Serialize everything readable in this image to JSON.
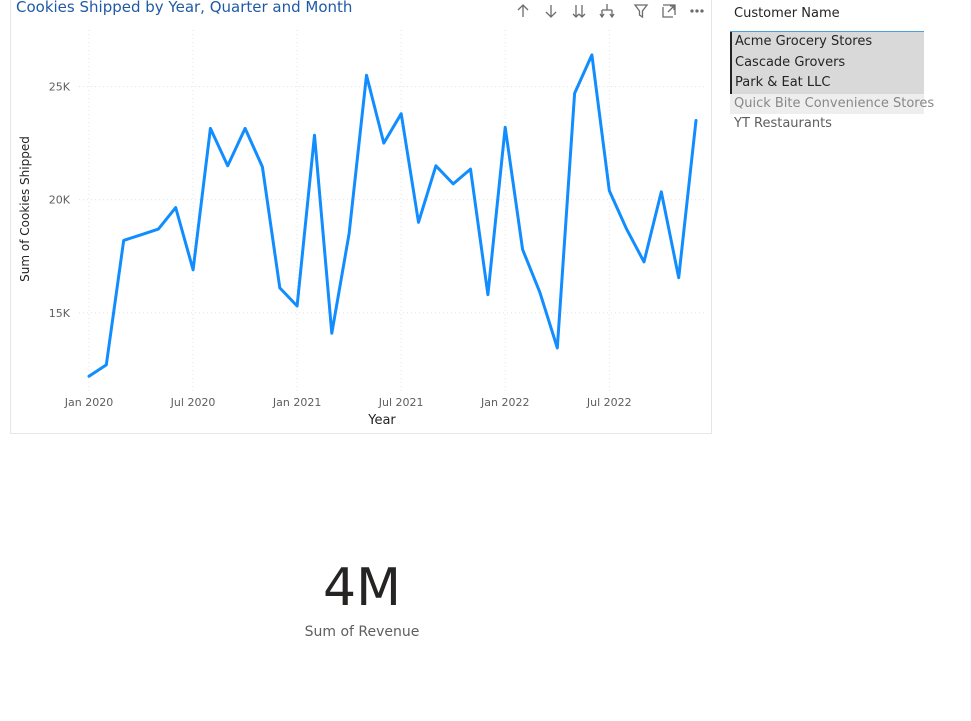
{
  "chart": {
    "title": "Cookies Shipped by Year, Quarter and Month",
    "toolbar_icons": [
      "drill-up-icon",
      "drill-down-icon",
      "expand-all-down-icon",
      "expand-hierarchy-icon",
      "filter-icon",
      "focus-mode-icon",
      "more-options-icon"
    ]
  },
  "chart_data": {
    "type": "line",
    "title": "Cookies Shipped by Year, Quarter and Month",
    "xlabel": "Year",
    "ylabel": "Sum of Cookies Shipped",
    "x_tick_labels": [
      "Jan 2020",
      "Jul 2020",
      "Jan 2021",
      "Jul 2021",
      "Jan 2022",
      "Jul 2022"
    ],
    "y_tick_labels": [
      "15K",
      "20K",
      "25K"
    ],
    "ylim": [
      11500,
      27500
    ],
    "grid": true,
    "line_color": "#118DFF",
    "x": [
      "Jan 2020",
      "Feb 2020",
      "Mar 2020",
      "Apr 2020",
      "May 2020",
      "Jun 2020",
      "Jul 2020",
      "Aug 2020",
      "Sep 2020",
      "Oct 2020",
      "Nov 2020",
      "Dec 2020",
      "Jan 2021",
      "Feb 2021",
      "Mar 2021",
      "Apr 2021",
      "May 2021",
      "Jun 2021",
      "Jul 2021",
      "Aug 2021",
      "Sep 2021",
      "Oct 2021",
      "Nov 2021",
      "Dec 2021",
      "Jan 2022",
      "Feb 2022",
      "Mar 2022",
      "Apr 2022",
      "May 2022",
      "Jun 2022",
      "Jul 2022",
      "Aug 2022",
      "Sep 2022",
      "Oct 2022",
      "Nov 2022",
      "Dec 2022"
    ],
    "values": [
      12200,
      12700,
      18200,
      18450,
      18700,
      19650,
      16900,
      23150,
      21500,
      23150,
      21450,
      16100,
      15300,
      22850,
      14100,
      18500,
      25500,
      22500,
      23800,
      19000,
      21500,
      20700,
      21350,
      15800,
      23200,
      17800,
      15900,
      13450,
      24700,
      26400,
      20400,
      18700,
      17250,
      20350,
      16550,
      23500
    ]
  },
  "slicer": {
    "title": "Customer Name",
    "items": [
      {
        "label": "Acme Grocery Stores",
        "state": "selected"
      },
      {
        "label": "Cascade Grovers",
        "state": "selected"
      },
      {
        "label": "Park & Eat LLC",
        "state": "selected"
      },
      {
        "label": "Quick Bite Convenience Stores",
        "state": "hovered"
      },
      {
        "label": "YT Restaurants",
        "state": "normal"
      }
    ]
  },
  "card": {
    "value": "4M",
    "label": "Sum of Revenue"
  }
}
